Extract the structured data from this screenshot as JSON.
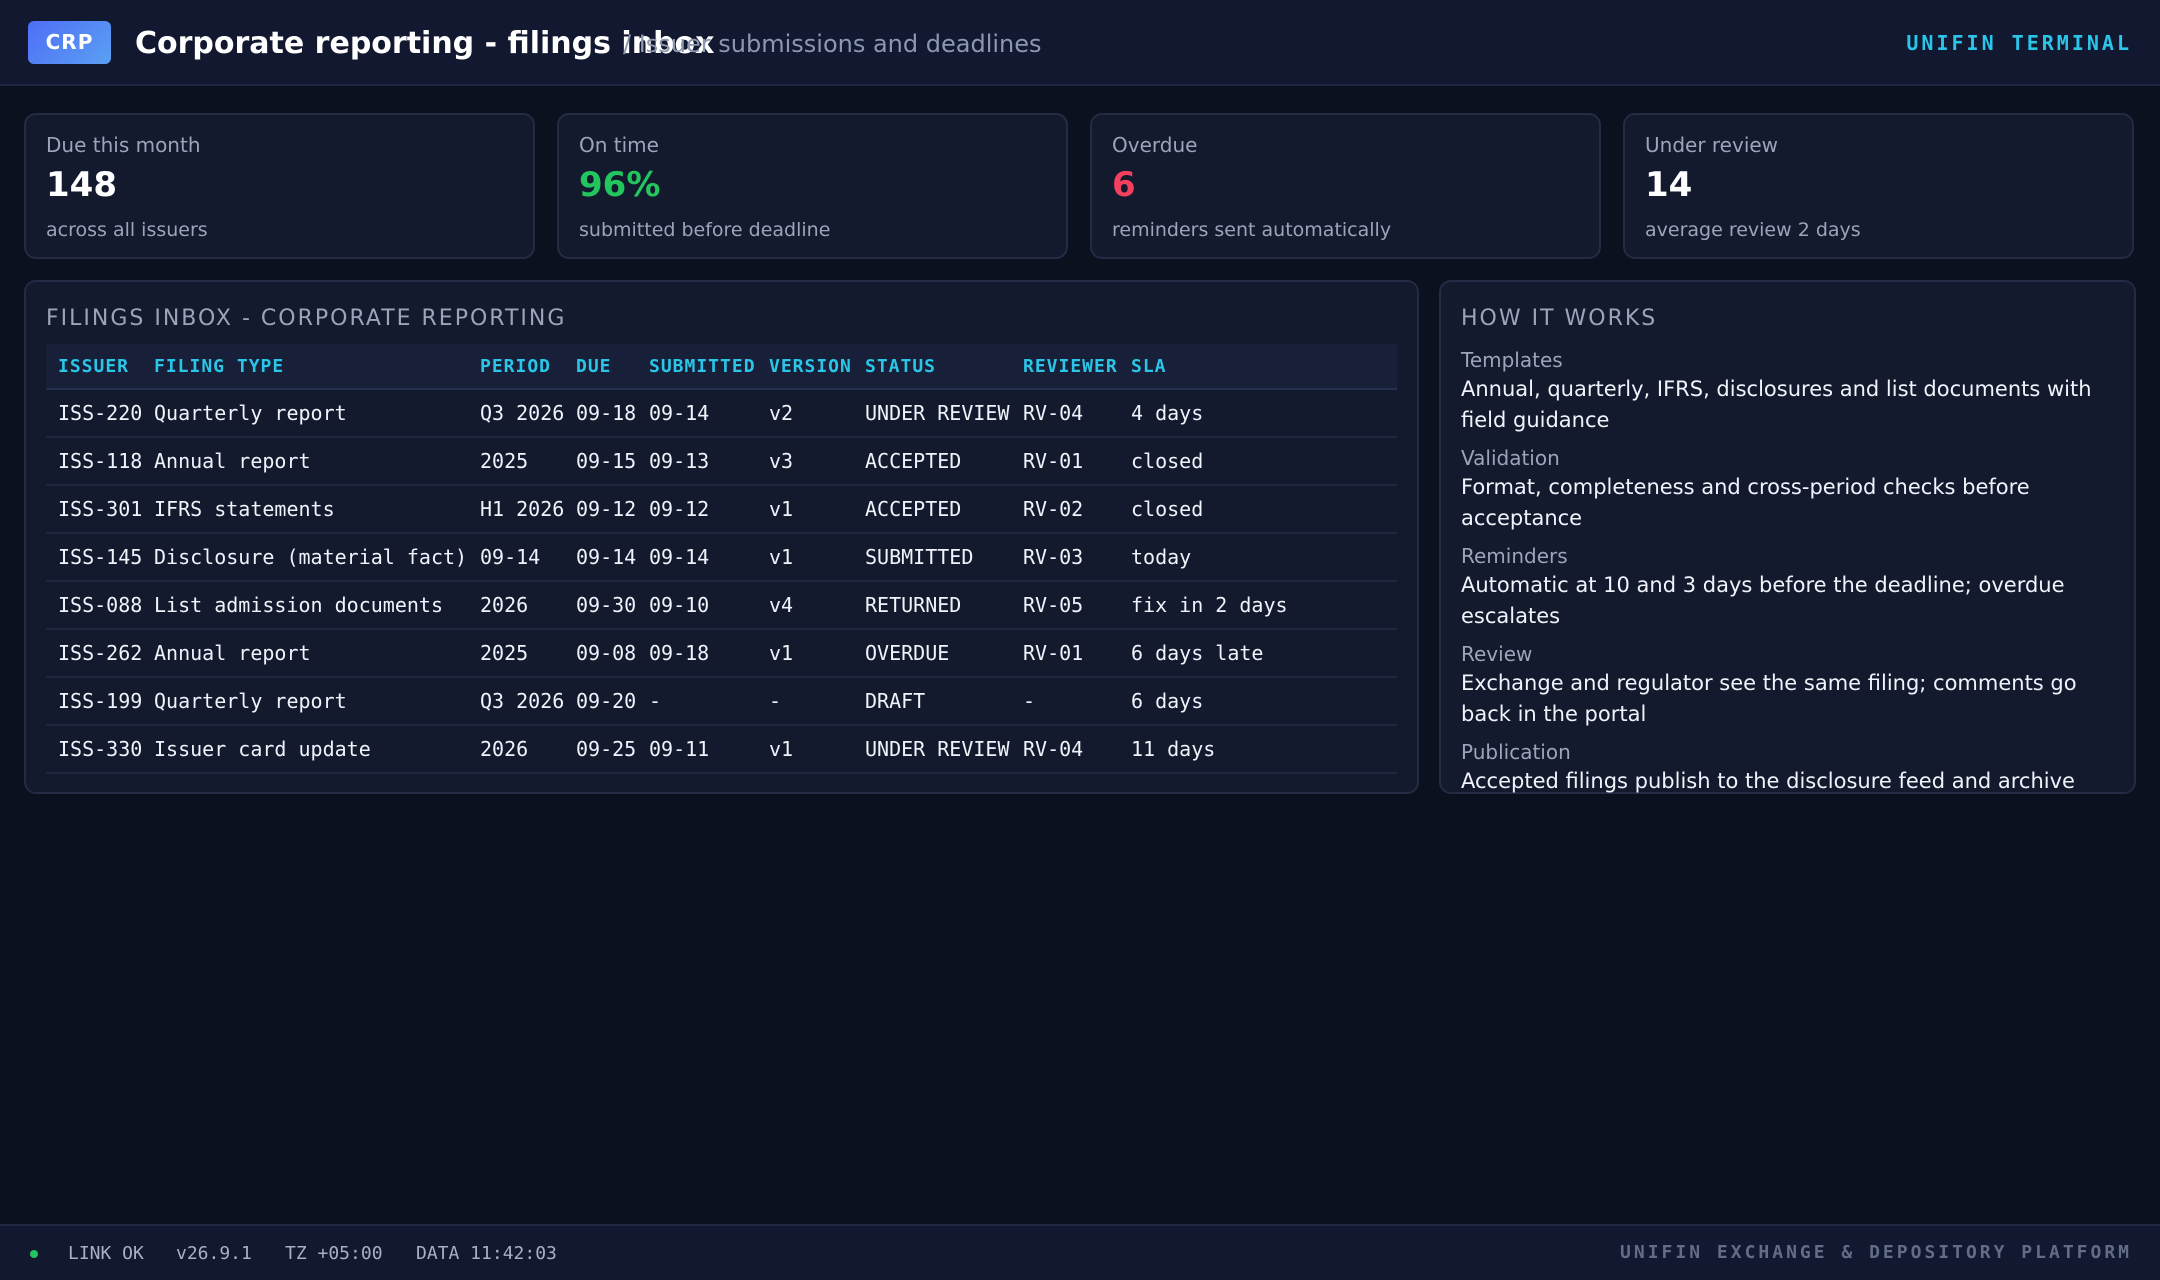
{
  "header": {
    "badge": "CRP",
    "title": "Corporate reporting - filings inbox",
    "subtitle": "/ Issuer submissions and deadlines",
    "brand": "UNIFIN TERMINAL"
  },
  "kpis": [
    {
      "label": "Due this month",
      "value": "148",
      "sub": "across all issuers"
    },
    {
      "label": "On time",
      "value": "96%",
      "sub": "submitted before deadline"
    },
    {
      "label": "Overdue",
      "value": "6",
      "sub": "reminders sent automatically"
    },
    {
      "label": "Under review",
      "value": "14",
      "sub": "average review 2 days"
    }
  ],
  "inbox": {
    "title": "FILINGS INBOX - CORPORATE REPORTING",
    "columns": [
      "ISSUER",
      "FILING TYPE",
      "PERIOD",
      "DUE",
      "SUBMITTED",
      "VERSION",
      "STATUS",
      "REVIEWER",
      "SLA"
    ],
    "rows": [
      [
        "ISS-220",
        "Quarterly report",
        "Q3 2026",
        "09-18",
        "09-14",
        "v2",
        "UNDER REVIEW",
        "RV-04",
        "4 days"
      ],
      [
        "ISS-118",
        "Annual report",
        "2025",
        "09-15",
        "09-13",
        "v3",
        "ACCEPTED",
        "RV-01",
        "closed"
      ],
      [
        "ISS-301",
        "IFRS statements",
        "H1 2026",
        "09-12",
        "09-12",
        "v1",
        "ACCEPTED",
        "RV-02",
        "closed"
      ],
      [
        "ISS-145",
        "Disclosure (material fact)",
        "09-14",
        "09-14",
        "09-14",
        "v1",
        "SUBMITTED",
        "RV-03",
        "today"
      ],
      [
        "ISS-088",
        "List admission documents",
        "2026",
        "09-30",
        "09-10",
        "v4",
        "RETURNED",
        "RV-05",
        "fix in 2 days"
      ],
      [
        "ISS-262",
        "Annual report",
        "2025",
        "09-08",
        "09-18",
        "v1",
        "OVERDUE",
        "RV-01",
        "6 days late"
      ],
      [
        "ISS-199",
        "Quarterly report",
        "Q3 2026",
        "09-20",
        "-",
        "-",
        "DRAFT",
        "-",
        "6 days"
      ],
      [
        "ISS-330",
        "Issuer card update",
        "2026",
        "09-25",
        "09-11",
        "v1",
        "UNDER REVIEW",
        "RV-04",
        "11 days"
      ]
    ]
  },
  "how": {
    "title": "HOW IT WORKS",
    "items": [
      {
        "label": "Templates",
        "desc": "Annual, quarterly, IFRS, disclosures and list documents with field guidance"
      },
      {
        "label": "Validation",
        "desc": "Format, completeness and cross-period checks before acceptance"
      },
      {
        "label": "Reminders",
        "desc": "Automatic at 10 and 3 days before the deadline; overdue escalates"
      },
      {
        "label": "Review",
        "desc": "Exchange and regulator see the same filing; comments go back in the portal"
      },
      {
        "label": "Publication",
        "desc": "Accepted filings publish to the disclosure feed and archive"
      }
    ]
  },
  "statusbar": {
    "link": "LINK OK",
    "version": "v26.9.1",
    "tz": "TZ +05:00",
    "data": "DATA 11:42:03",
    "platform": "UNIFIN EXCHANGE & DEPOSITORY PLATFORM"
  },
  "colors": {
    "accent": "#2bc5e8",
    "positive": "#22c55e",
    "negative": "#f43f5e",
    "background": "#0c1120"
  }
}
